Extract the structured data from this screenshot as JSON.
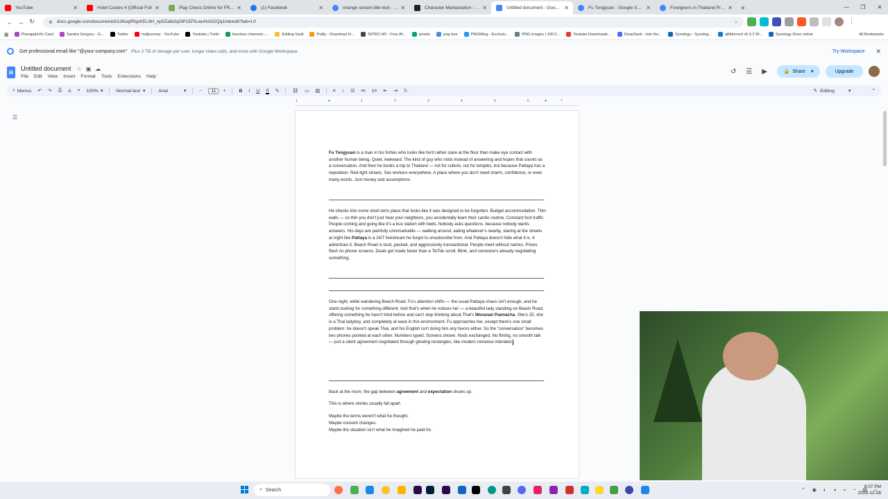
{
  "browser": {
    "tabs": [
      {
        "label": "YouTube",
        "color": "#ff0000",
        "active": false
      },
      {
        "label": "Hotel Costes 4 (Official Full",
        "color": "#ff0000",
        "active": false
      },
      {
        "label": "Play Chess Online for FREE - 2",
        "color": "#7fa650",
        "active": false
      },
      {
        "label": "(1) Facebook",
        "color": "#1877f2",
        "active": false
      },
      {
        "label": "change stream title kick - Goog",
        "color": "#4285f4",
        "active": false
      },
      {
        "label": "Character Manipulation - AI Im",
        "color": "#222222",
        "active": false
      },
      {
        "label": "Untitled document - Google Do",
        "color": "#4285f4",
        "active": true
      },
      {
        "label": "Fu Tongyuan - Google Search",
        "color": "#4285f4",
        "active": false
      },
      {
        "label": "Foreigners in Thailand Prison",
        "color": "#4285f4",
        "active": false
      }
    ],
    "url": "docs.google.com/document/d/139oqiRfqsKEL9H_npSZaMJqOlP1EFtLwuHxGGQq1rbk/edit?tab=t.0",
    "bookmarks": [
      "PineappleViz Card",
      "Sandra Gregory - G...",
      "Twitter",
      "midjourney - YouTube",
      "Youtube | Trello",
      "faceless channels -...",
      "Editing Vault",
      "Psdly - Download Fr...",
      "INTRO HD - Free Af...",
      "pexels",
      "png tree",
      "PNGWing - Exclusiv...",
      "PNG images | 100 0...",
      "Youtube Downloade...",
      "DeepSeek - Into the...",
      "Synology - Synolog...",
      "qBittorrent v5.0.2 W...",
      "Synology Drive online"
    ],
    "all_bookmarks": "All Bookmarks"
  },
  "banner": {
    "title": "Get professional email like \"@your-company.com\"",
    "text": "Plus 2 TB of storage per user, longer video calls, and more with Google Workspace.",
    "cta": "Try Workspace"
  },
  "docs": {
    "title": "Untitled document",
    "menu": [
      "File",
      "Edit",
      "View",
      "Insert",
      "Format",
      "Tools",
      "Extensions",
      "Help"
    ],
    "share_label": "Share",
    "upgrade_label": "Upgrade",
    "toolbar": {
      "menus": "Menus",
      "zoom": "100%",
      "style": "Normal text",
      "font": "Arial",
      "font_size": "11",
      "mode": "Editing"
    },
    "ruler": [
      "1",
      "1",
      "2",
      "3",
      "4",
      "5",
      "6",
      "7"
    ]
  },
  "document": {
    "p1_name": "Fu Tongyuan",
    "p1_rest": " is a man in his forties who looks like he'd rather stare at the floor than make eye contact with another human being. Quiet. Awkward. The kind of guy who nods instead of answering and hopes that counts as a conversation. And then he books a trip to Thailand — not for culture, not for temples, but because Pattaya has a reputation. Red-light streets. Sex workers everywhere. A place where you don't need charm, confidence, or even many words. Just money and assumptions.",
    "p2_a": "He checks into some short-term place that looks like it was designed to be forgotten. Budget accommodation. Thin walls — so thin you don't just hear your neighbors, you accidentally learn their cardio routine. Constant foot traffic. People coming and going like it's a bus station with beds. Nobody asks questions, because nobody wants answers. His days are painfully unremarkable — walking around, eating whatever's nearby, staring at the streets at night like ",
    "p2_bold": "Pattaya",
    "p2_b": " is a 24/7 livestream he forgot to unsubscribe from. And Pattaya doesn't hide what it is. It advertises it. Beach Road is loud, packed, and aggressively transactional. People meet without names. Prices flash on phone screens. Deals get made faster than a TikTok scroll. Blink, and someone's already negotiating something.",
    "p3_a": "One night, while wandering Beach Road, Fu's attention shifts — the usual Pattaya chaos isn't enough, and he starts looking for something different. And that's when he notices her — a beautiful lady standing on Beach Road, offering something he hasn't tried before and can't stop thinking about.That's ",
    "p3_bold": "Woranan Pannacha",
    "p3_b": ". She's 25, she is a Thai ladyboy, and completely at ease in this environment. Fu approaches her, except there's one small problem: he doesn't speak Thai, and his English isn't doing him any favors either. So the \"conversation\" becomes two phones pointed at each other. Numbers typed. Screens shown. Nods exchanged. No flirting, no smooth talk — just a silent agreement negotiated through glowing rectangles, like modern romance intended.",
    "l1_a": "Back at the room, the gap between ",
    "l1_b1": "agreement",
    "l1_mid": " and ",
    "l1_b2": "expectation",
    "l1_c": " shows up.",
    "l2": "This is where stories usually fall apart.",
    "l3": "Maybe the terms weren't what he thought.",
    "l4": " Maybe consent changes.",
    "l5": " Maybe the situation isn't what he imagined he paid for."
  },
  "taskbar": {
    "search": "Search",
    "time": "8:07 PM",
    "date": "2025-12-26"
  }
}
